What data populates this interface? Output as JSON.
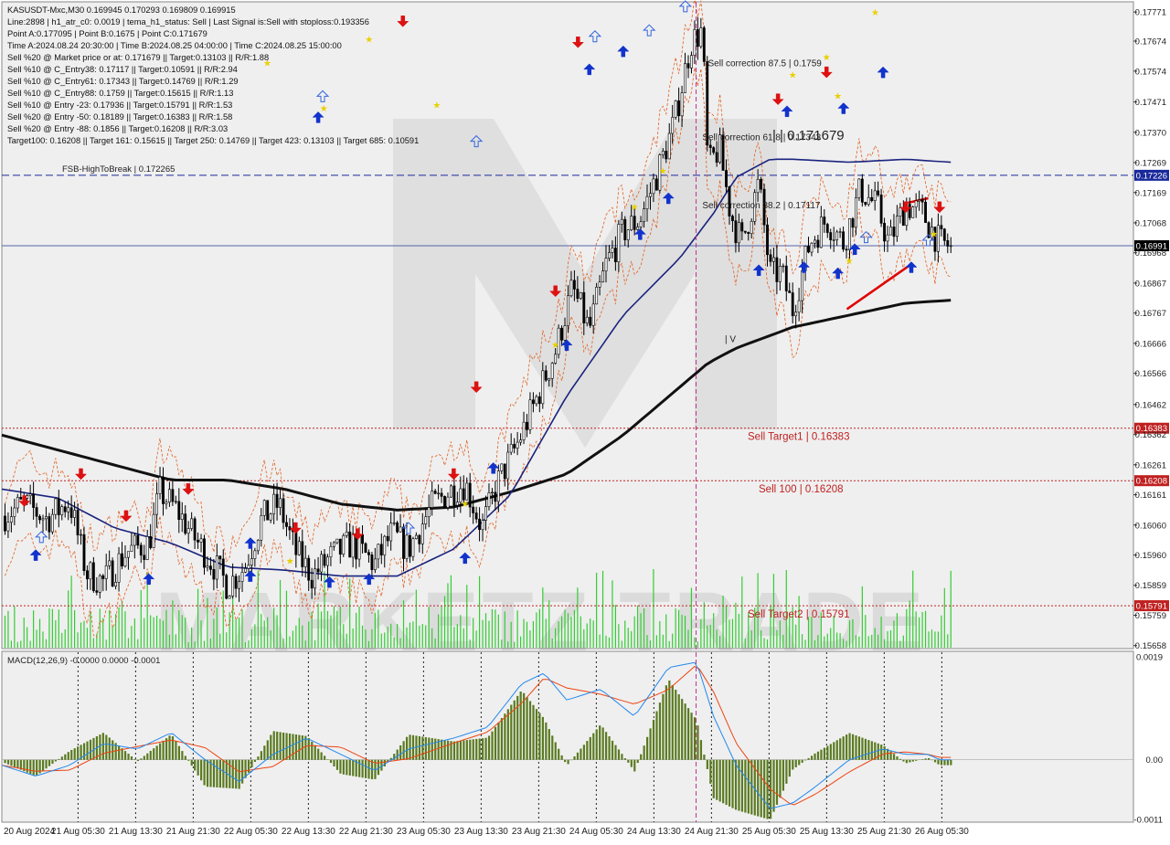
{
  "chart_data": {
    "type": "candlestick",
    "symbol": "KASUSDT-Mxc,M30",
    "ohlc": [
      0.169945,
      0.170293,
      0.169809,
      0.169915
    ],
    "info_lines": [
      "Line:2898 | h1_atr_c0: 0.0019 | tema_h1_status: Sell | Last Signal is:Sell with stoploss:0.193356",
      "Point A:0.177095 | Point B:0.1675 | Point C:0.171679",
      "Time A:2024.08.24 20:30:00 | Time B:2024.08.25 04:00:00 | Time C:2024.08.25 15:00:00",
      "Sell %20 @ Market price or at: 0.171679 || Target:0.13103 || R/R:1.88",
      "Sell %10 @ C_Entry38: 0.17117 || Target:0.10591 || R/R:2.94",
      "Sell %10 @ C_Entry61: 0.17343 || Target:0.14769 || R/R:1.29",
      "Sell %10 @ C_Entry88: 0.1759 || Target:0.15615 || R/R:1.13",
      "Sell %10 @ Entry -23: 0.17936 || Target:0.15791 || R/R:1.53",
      "Sell %20 @ Entry -50: 0.18189 || Target:0.16383 || R/R:1.58",
      "Sell %20 @ Entry -88: 0.1856 || Target:0.16208 || R/R:3.03",
      "Target100: 0.16208 || Target 161: 0.15615 || Target 250: 0.14769 || Target 423: 0.13103 || Target 685: 0.10591"
    ],
    "price_axis": [
      "0.17771",
      "0.17674",
      "0.17574",
      "0.17471",
      "0.17370",
      "0.17269",
      "0.17169",
      "0.17068",
      "0.16968",
      "0.16867",
      "0.16767",
      "0.16666",
      "0.16566",
      "0.16462",
      "0.16362",
      "0.16261",
      "0.16161",
      "0.16060",
      "0.15960",
      "0.15859",
      "0.15759",
      "0.15658"
    ],
    "ylim": [
      0.15648,
      0.17805
    ],
    "time_labels": [
      "20 Aug 2024",
      "21 Aug 05:30",
      "21 Aug 13:30",
      "21 Aug 21:30",
      "22 Aug 05:30",
      "22 Aug 13:30",
      "22 Aug 21:30",
      "23 Aug 05:30",
      "23 Aug 13:30",
      "23 Aug 21:30",
      "24 Aug 05:30",
      "24 Aug 13:30",
      "24 Aug 21:30",
      "25 Aug 05:30",
      "25 Aug 13:30",
      "25 Aug 21:30",
      "26 Aug 05:30"
    ],
    "levels": [
      {
        "label": "FSB-HighToBreak | 0.172265",
        "value": 0.172265,
        "tag": "0.17226",
        "color": "#1a2a9c",
        "style": "dashed"
      },
      {
        "label": "",
        "value": 0.169915,
        "tag": "0.16991",
        "color": "#5566aa",
        "style": "solid"
      },
      {
        "label": "Sell Target1 | 0.16383",
        "value": 0.16383,
        "tag": "0.16383",
        "color": "#c02020",
        "style": "dotted"
      },
      {
        "label": "Sell 100 | 0.16208",
        "value": 0.16208,
        "tag": "0.16208",
        "color": "#c02020",
        "style": "dotted"
      },
      {
        "label": "Sell Target2 | 0.15791",
        "value": 0.15791,
        "tag": "0.15791",
        "color": "#c02020",
        "style": "dotted"
      }
    ],
    "annotations": [
      {
        "text": "Sell correction 87.5 | 0.1759",
        "price": 0.1759,
        "t": 0.625
      },
      {
        "text": "Sell correction 61.8 | 0.17343",
        "price": 0.17343,
        "t": 0.62
      },
      {
        "text": "Sell correction 38.2 | 0.17117",
        "price": 0.17117,
        "t": 0.62
      },
      {
        "text": "| | 0.171679",
        "price": 0.17345,
        "t": 0.682
      },
      {
        "text": "| V",
        "price": 0.1667,
        "t": 0.64
      }
    ],
    "watermark": "MARKETZ TRADE",
    "macd": {
      "label": "MACD(12,26,9) -0.0000 0.0000 -0.0001",
      "axis": [
        "0.0019",
        "0.00",
        "-0.0011"
      ],
      "ylim": [
        -0.00115,
        0.002
      ]
    },
    "price_path": [
      [
        0,
        0.1609
      ],
      [
        0.02,
        0.1613
      ],
      [
        0.04,
        0.1608
      ],
      [
        0.06,
        0.1614
      ],
      [
        0.075,
        0.159
      ],
      [
        0.09,
        0.1587
      ],
      [
        0.11,
        0.1597
      ],
      [
        0.13,
        0.16
      ],
      [
        0.14,
        0.1617
      ],
      [
        0.155,
        0.1611
      ],
      [
        0.17,
        0.1602
      ],
      [
        0.185,
        0.1594
      ],
      [
        0.2,
        0.1586
      ],
      [
        0.215,
        0.1592
      ],
      [
        0.23,
        0.1608
      ],
      [
        0.245,
        0.1613
      ],
      [
        0.26,
        0.1597
      ],
      [
        0.275,
        0.1589
      ],
      [
        0.29,
        0.1595
      ],
      [
        0.31,
        0.16
      ],
      [
        0.33,
        0.1593
      ],
      [
        0.345,
        0.1603
      ],
      [
        0.36,
        0.1598
      ],
      [
        0.38,
        0.1612
      ],
      [
        0.395,
        0.1617
      ],
      [
        0.41,
        0.162
      ],
      [
        0.425,
        0.1605
      ],
      [
        0.44,
        0.1621
      ],
      [
        0.455,
        0.1632
      ],
      [
        0.47,
        0.1645
      ],
      [
        0.49,
        0.1664
      ],
      [
        0.505,
        0.1685
      ],
      [
        0.52,
        0.1671
      ],
      [
        0.535,
        0.1693
      ],
      [
        0.55,
        0.1704
      ],
      [
        0.565,
        0.1708
      ],
      [
        0.58,
        0.1723
      ],
      [
        0.595,
        0.174
      ],
      [
        0.61,
        0.1767
      ],
      [
        0.62,
        0.1771
      ],
      [
        0.625,
        0.1725
      ],
      [
        0.635,
        0.1732
      ],
      [
        0.645,
        0.171
      ],
      [
        0.655,
        0.17
      ],
      [
        0.67,
        0.172
      ],
      [
        0.68,
        0.169
      ],
      [
        0.69,
        0.169
      ],
      [
        0.7,
        0.1678
      ],
      [
        0.715,
        0.17
      ],
      [
        0.73,
        0.1708
      ],
      [
        0.745,
        0.17
      ],
      [
        0.76,
        0.1718
      ],
      [
        0.775,
        0.1712
      ],
      [
        0.785,
        0.17
      ],
      [
        0.8,
        0.1713
      ],
      [
        0.815,
        0.171
      ],
      [
        0.83,
        0.17
      ],
      [
        0.84,
        0.1699
      ]
    ],
    "ma_slow": [
      [
        0,
        0.1636
      ],
      [
        0.05,
        0.1631
      ],
      [
        0.1,
        0.1626
      ],
      [
        0.15,
        0.1621
      ],
      [
        0.2,
        0.1621
      ],
      [
        0.25,
        0.1618
      ],
      [
        0.3,
        0.1613
      ],
      [
        0.35,
        0.1611
      ],
      [
        0.4,
        0.1612
      ],
      [
        0.45,
        0.1617
      ],
      [
        0.5,
        0.1623
      ],
      [
        0.55,
        0.1636
      ],
      [
        0.6,
        0.1652
      ],
      [
        0.625,
        0.166
      ],
      [
        0.65,
        0.1665
      ],
      [
        0.7,
        0.1672
      ],
      [
        0.75,
        0.1676
      ],
      [
        0.8,
        0.168
      ],
      [
        0.84,
        0.1681
      ]
    ],
    "ma_fast": [
      [
        0,
        0.1618
      ],
      [
        0.05,
        0.1615
      ],
      [
        0.1,
        0.1605
      ],
      [
        0.15,
        0.16
      ],
      [
        0.2,
        0.1592
      ],
      [
        0.25,
        0.1591
      ],
      [
        0.3,
        0.1589
      ],
      [
        0.35,
        0.1589
      ],
      [
        0.4,
        0.1598
      ],
      [
        0.45,
        0.1616
      ],
      [
        0.5,
        0.1649
      ],
      [
        0.55,
        0.1676
      ],
      [
        0.6,
        0.1695
      ],
      [
        0.63,
        0.171
      ],
      [
        0.65,
        0.1722
      ],
      [
        0.68,
        0.1728
      ],
      [
        0.7,
        0.1728
      ],
      [
        0.75,
        0.1727
      ],
      [
        0.8,
        0.1728
      ],
      [
        0.84,
        0.1727
      ]
    ]
  }
}
